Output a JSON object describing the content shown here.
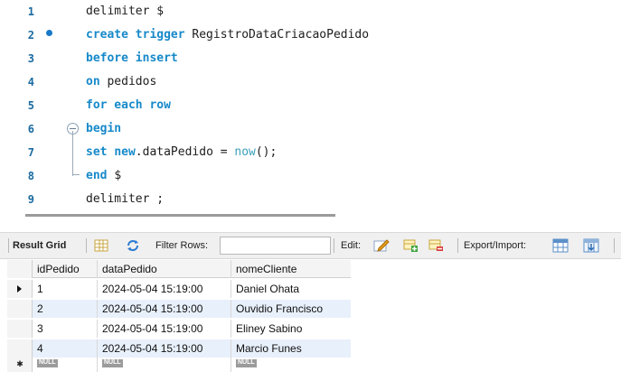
{
  "editor": {
    "lines": [
      {
        "num": "1",
        "parts": [
          {
            "t": "delimiter $",
            "c": ""
          }
        ]
      },
      {
        "num": "2",
        "parts": [
          {
            "t": "create trigger ",
            "c": "kw"
          },
          {
            "t": "RegistroDataCriacaoPedido",
            "c": ""
          }
        ]
      },
      {
        "num": "3",
        "parts": [
          {
            "t": "before insert",
            "c": "kw"
          }
        ]
      },
      {
        "num": "4",
        "parts": [
          {
            "t": "on ",
            "c": "kw"
          },
          {
            "t": "pedidos",
            "c": ""
          }
        ]
      },
      {
        "num": "5",
        "parts": [
          {
            "t": "for each row",
            "c": "kw"
          }
        ]
      },
      {
        "num": "6",
        "parts": [
          {
            "t": "begin",
            "c": "kw"
          }
        ]
      },
      {
        "num": "7",
        "parts": [
          {
            "t": "set ",
            "c": "kw"
          },
          {
            "t": "new",
            "c": "kw"
          },
          {
            "t": ".dataPedido = ",
            "c": ""
          },
          {
            "t": "now",
            "c": "fn"
          },
          {
            "t": "();",
            "c": ""
          }
        ]
      },
      {
        "num": "8",
        "parts": [
          {
            "t": "end ",
            "c": "kw"
          },
          {
            "t": "$",
            "c": ""
          }
        ]
      },
      {
        "num": "9",
        "parts": [
          {
            "t": "delimiter ;",
            "c": ""
          }
        ]
      }
    ]
  },
  "toolbar": {
    "result_grid": "Result Grid",
    "filter_rows": "Filter Rows:",
    "filter_value": "",
    "edit": "Edit:",
    "export_import": "Export/Import:"
  },
  "grid": {
    "columns": [
      "idPedido",
      "dataPedido",
      "nomeCliente"
    ],
    "rows": [
      [
        "1",
        "2024-05-04 15:19:00",
        "Daniel Ohata"
      ],
      [
        "2",
        "2024-05-04 15:19:00",
        "Ouvidio Francisco"
      ],
      [
        "3",
        "2024-05-04 15:19:00",
        "Eliney Sabino"
      ],
      [
        "4",
        "2024-05-04 15:19:00",
        "Marcio Funes"
      ]
    ],
    "null_label": "NULL"
  }
}
